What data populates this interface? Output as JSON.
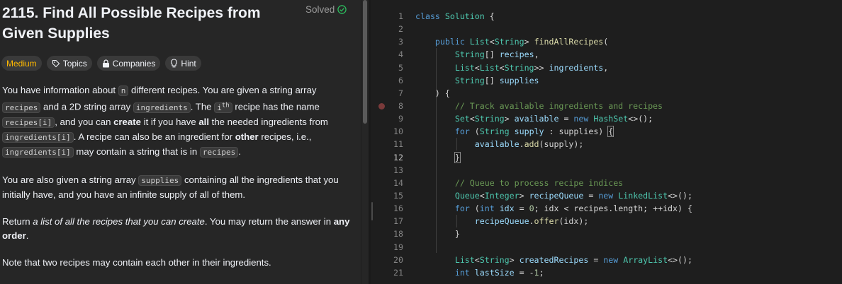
{
  "problem": {
    "title": "2115. Find All Possible Recipes from Given Supplies",
    "status": "Solved",
    "difficulty": "Medium",
    "tags": [
      "Topics",
      "Companies",
      "Hint"
    ]
  },
  "description": {
    "p1": {
      "t1": "You have information about ",
      "c1": "n",
      "t2": " different recipes. You are given a string array ",
      "c2": "recipes",
      "t3": " and a 2D string array ",
      "c3": "ingredients",
      "t4": ". The ",
      "c4a": "i",
      "c4b": "th",
      "t5": " recipe has the name ",
      "c5": "recipes[i]",
      "t6": ", and you can ",
      "b1": "create",
      "t7": " it if you have ",
      "b2": "all",
      "t8": " the needed ingredients from ",
      "c6": "ingredients[i]",
      "t9": ". A recipe can also be an ingredient for ",
      "b3": "other",
      "t10": " recipes, i.e., ",
      "c7": "ingredients[i]",
      "t11": " may contain a string that is in ",
      "c8": "recipes",
      "t12": "."
    },
    "p2": {
      "t1": "You are also given a string array ",
      "c1": "supplies",
      "t2": " containing all the ingredients that you initially have, and you have an infinite supply of all of them."
    },
    "p3": {
      "t1": "Return ",
      "i1": "a list of all the recipes that you can create",
      "t2": ". You may return the answer in ",
      "b1": "any order",
      "t3": "."
    },
    "p4": "Note that two recipes may contain each other in their ingredients."
  },
  "editor": {
    "active_line": 12,
    "breakpoint_line": 8,
    "line_numbers": [
      "1",
      "2",
      "3",
      "4",
      "5",
      "6",
      "7",
      "8",
      "9",
      "10",
      "11",
      "12",
      "13",
      "14",
      "15",
      "16",
      "17",
      "18",
      "19",
      "20",
      "21"
    ]
  }
}
